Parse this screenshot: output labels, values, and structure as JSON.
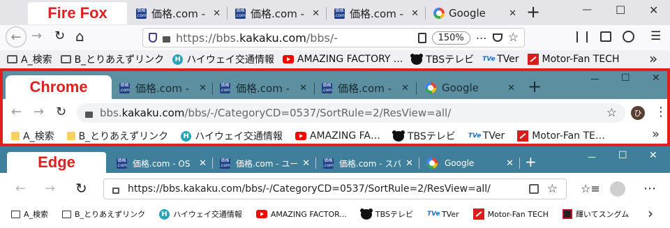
{
  "firefox": {
    "label": "Fire Fox",
    "tabs": [
      {
        "title": "価格.com -",
        "icon": "kakaku-icon"
      },
      {
        "title": "価格.com -",
        "icon": "kakaku-icon"
      },
      {
        "title": "価格.com -",
        "icon": "kakaku-icon"
      },
      {
        "title": "Google",
        "icon": "google-icon"
      }
    ],
    "favicon_text": "価格\n.com",
    "url_prefix": "https://bbs.",
    "url_domain": "kakaku.com",
    "url_suffix": "/bbs/-",
    "zoom": "150%",
    "bookmarks": [
      "A_検索",
      "B_とりあえずリンク",
      "ハイウェイ交通情報",
      "AMAZING FACTORY ...",
      "TBSテレビ",
      "TVer",
      "Motor-Fan TECH"
    ]
  },
  "chrome": {
    "label": "Chrome",
    "tabs": [
      {
        "title": "価格.com -",
        "icon": "kakaku-icon"
      },
      {
        "title": "価格.com -",
        "icon": "kakaku-icon"
      },
      {
        "title": "価格.com -",
        "icon": "kakaku-icon"
      },
      {
        "title": "Google",
        "icon": "google-icon"
      }
    ],
    "url_prefix": "bbs.",
    "url_domain": "kakaku.com",
    "url_suffix": "/bbs/-/CategoryCD=0537/SortRule=2/ResView=all/",
    "profile_initial": "ひ",
    "bookmarks": [
      "A_検索",
      "B_とりあえずリンク",
      "ハイウェイ交通情報",
      "AMAZING FA…",
      "TBSテレビ",
      "TVer",
      "Motor-Fan TE…"
    ]
  },
  "edge": {
    "label": "Edge",
    "tabs": [
      {
        "title": "価格.com - OS",
        "icon": "kakaku-icon"
      },
      {
        "title": "価格.com - ユー",
        "icon": "kakaku-icon"
      },
      {
        "title": "価格.com - スパ",
        "icon": "kakaku-icon"
      },
      {
        "title": "Google",
        "icon": "google-icon"
      }
    ],
    "url": "https://bbs.kakaku.com/bbs/-/CategoryCD=0537/SortRule=2/ResView=all/",
    "bookmarks": [
      "A_検索",
      "B_とりあえずリンク",
      "ハイウェイ交通情報",
      "AMAZING FACTOR...",
      "TBSテレビ",
      "TVer",
      "Motor-Fan TECH",
      "輝いてスングム"
    ]
  },
  "glyphs": {
    "close": "✕",
    "plus": "+",
    "minimize": "—",
    "maximize": "☐",
    "back": "←",
    "forward": "→",
    "reload": "↻",
    "home": "⌂",
    "star": "☆",
    "more": "⋯",
    "chevron": "›",
    "double_chevron": "»",
    "menu": "☰",
    "kebab": "⋮"
  },
  "colors": {
    "firefox_red": "#e0201f",
    "chrome_tabbar": "#5c8fa0",
    "edge_tabbar": "#3f7f9b",
    "highlight_border": "#e0201f",
    "kakaku_blue": "#1e3f8a"
  }
}
